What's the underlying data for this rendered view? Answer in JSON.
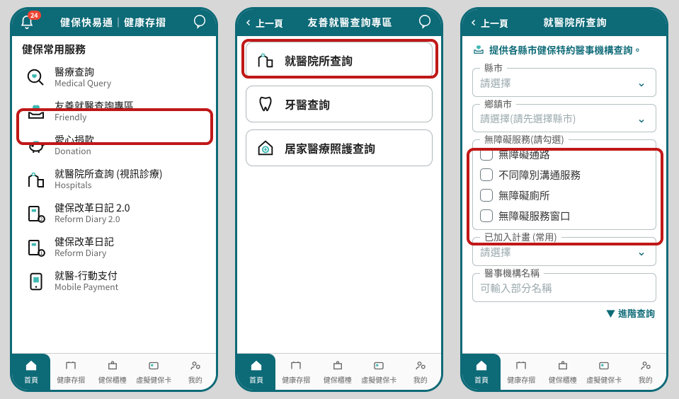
{
  "screen1": {
    "header": {
      "title": "健保快易通｜健康存摺",
      "badge": "24"
    },
    "section_title": "健保常用服務",
    "services": [
      {
        "zh": "醫療查詢",
        "en": "Medical Query"
      },
      {
        "zh": "友善就醫查詢專區",
        "en": "Friendly"
      },
      {
        "zh": "愛心捐款",
        "en": "Donation"
      },
      {
        "zh": "就醫院所查詢 (視訊診療)",
        "en": "Hospitals"
      },
      {
        "zh": "健保改革日記 2.0",
        "en": "Reform Diary 2.0"
      },
      {
        "zh": "健保改革日記",
        "en": "Reform Diary"
      },
      {
        "zh": "就醫-行動支付",
        "en": "Mobile Payment"
      }
    ]
  },
  "screen2": {
    "back": "上一頁",
    "title": "友善就醫查詢專區",
    "cards": [
      {
        "label": "就醫院所查詢"
      },
      {
        "label": "牙醫查詢"
      },
      {
        "label": "居家醫療照護查詢"
      }
    ]
  },
  "screen3": {
    "back": "上一頁",
    "title": "就醫院所查詢",
    "intro": "提供各縣市健保特約醫事機構查詢。",
    "fields": {
      "county": {
        "legend": "縣市",
        "placeholder": "請選擇"
      },
      "town": {
        "legend": "鄉鎮市",
        "placeholder": "請選擇(請先選擇縣市)"
      },
      "accessible": {
        "legend": "無障礙服務(請勾選)",
        "options": [
          "無障礙通路",
          "不同障別溝通服務",
          "無障礙廁所",
          "無障礙服務窗口"
        ]
      },
      "plan": {
        "legend": "已加入計畫 (常用)",
        "placeholder": "請選擇"
      },
      "name": {
        "legend": "醫事機構名稱",
        "placeholder": "可輸入部分名稱"
      }
    },
    "advanced": "進階查詢"
  },
  "tabs": {
    "home": "首頁",
    "passbook": "健康存摺",
    "rights": "健保櫃檯",
    "vcard": "虛擬健保卡",
    "mine": "我的"
  }
}
